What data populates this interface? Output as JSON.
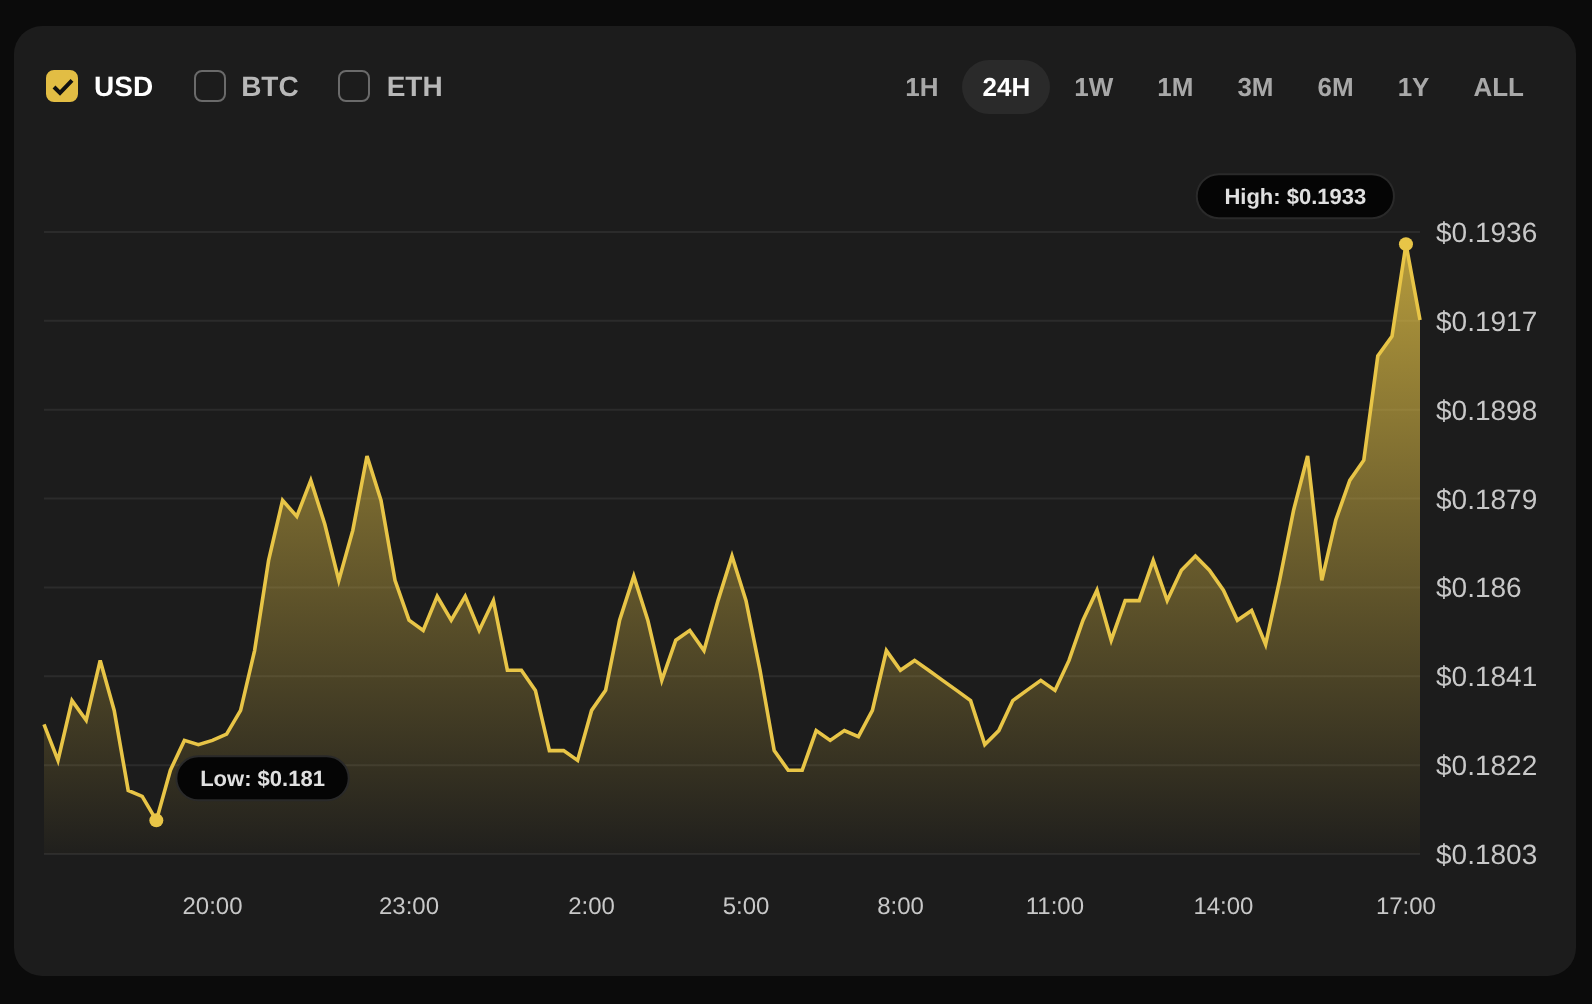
{
  "currencies": [
    {
      "label": "USD",
      "checked": true
    },
    {
      "label": "BTC",
      "checked": false
    },
    {
      "label": "ETH",
      "checked": false
    }
  ],
  "ranges": [
    {
      "label": "1H",
      "selected": false
    },
    {
      "label": "24H",
      "selected": true
    },
    {
      "label": "1W",
      "selected": false
    },
    {
      "label": "1M",
      "selected": false
    },
    {
      "label": "3M",
      "selected": false
    },
    {
      "label": "6M",
      "selected": false
    },
    {
      "label": "1Y",
      "selected": false
    },
    {
      "label": "ALL",
      "selected": false
    }
  ],
  "chart_data": {
    "type": "area",
    "categories": [
      null,
      null,
      null,
      null,
      null,
      null,
      null,
      null,
      null,
      null,
      null,
      null,
      "20:00",
      null,
      null,
      null,
      null,
      null,
      null,
      null,
      null,
      null,
      null,
      null,
      null,
      null,
      "23:00",
      null,
      null,
      null,
      null,
      null,
      null,
      null,
      null,
      null,
      null,
      null,
      null,
      "2:00",
      null,
      null,
      null,
      null,
      null,
      null,
      null,
      null,
      null,
      null,
      "5:00",
      null,
      null,
      null,
      null,
      null,
      null,
      null,
      null,
      null,
      null,
      "8:00",
      null,
      null,
      null,
      null,
      null,
      null,
      null,
      null,
      null,
      null,
      "11:00",
      null,
      null,
      null,
      null,
      null,
      null,
      null,
      null,
      null,
      null,
      null,
      "14:00",
      null,
      null,
      null,
      null,
      null,
      null,
      null,
      null,
      null,
      null,
      null,
      null,
      "17:00",
      null
    ],
    "series": [
      {
        "color": "#e8c547",
        "values": [
          0.18307,
          0.1823,
          0.18358,
          0.18316,
          0.18444,
          0.18337,
          0.18166,
          0.18153,
          0.18102,
          0.18209,
          0.18273,
          0.18264,
          0.18273,
          0.18286,
          0.18337,
          0.18465,
          0.18658,
          0.18786,
          0.18752,
          0.18829,
          0.18735,
          0.18615,
          0.18722,
          0.18881,
          0.18786,
          0.18615,
          0.1853,
          0.18508,
          0.18581,
          0.1853,
          0.18581,
          0.18508,
          0.18572,
          0.18423,
          0.18423,
          0.1838,
          0.18251,
          0.18251,
          0.1823,
          0.18337,
          0.1838,
          0.1853,
          0.18624,
          0.1853,
          0.18401,
          0.18487,
          0.18508,
          0.18465,
          0.18572,
          0.18667,
          0.18572,
          0.18423,
          0.18251,
          0.18209,
          0.18209,
          0.18294,
          0.18273,
          0.18294,
          0.18281,
          0.18337,
          0.18465,
          0.18423,
          0.18444,
          0.18423,
          0.18401,
          0.1838,
          0.18358,
          0.18264,
          0.18294,
          0.18358,
          0.1838,
          0.18401,
          0.1838,
          0.18444,
          0.1853,
          0.18594,
          0.18487,
          0.18572,
          0.18572,
          0.18658,
          0.18572,
          0.18637,
          0.18667,
          0.18637,
          0.18594,
          0.1853,
          0.18551,
          0.18478,
          0.18615,
          0.18765,
          0.18881,
          0.18615,
          0.18744,
          0.18829,
          0.18872,
          0.19095,
          0.19137,
          0.19334,
          0.19172
        ]
      }
    ],
    "grid": true,
    "ylim": [
      0.1803,
      0.1936
    ],
    "yticks": [
      {
        "value": 0.1936,
        "label": "$0.1936"
      },
      {
        "value": 0.1917,
        "label": "$0.1917"
      },
      {
        "value": 0.1898,
        "label": "$0.1898"
      },
      {
        "value": 0.1879,
        "label": "$0.1879"
      },
      {
        "value": 0.186,
        "label": "$0.186"
      },
      {
        "value": 0.1841,
        "label": "$0.1841"
      },
      {
        "value": 0.1822,
        "label": "$0.1822"
      },
      {
        "value": 0.1803,
        "label": "$0.1803"
      }
    ],
    "annotations": [
      "High: $0.1933",
      "Low: $0.181"
    ]
  }
}
